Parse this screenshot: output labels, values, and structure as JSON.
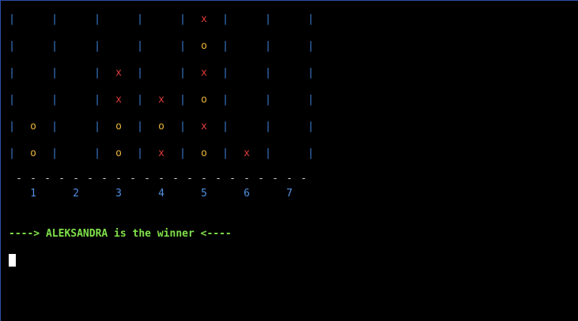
{
  "game": {
    "separator": "|",
    "tokens": {
      "x": "x",
      "o": "o"
    },
    "grid": [
      [
        "",
        "",
        "",
        "",
        "x",
        "",
        ""
      ],
      [
        "",
        "",
        "",
        "",
        "o",
        "",
        ""
      ],
      [
        "",
        "",
        "x",
        "",
        "x",
        "",
        ""
      ],
      [
        "",
        "",
        "x",
        "x",
        "o",
        "",
        ""
      ],
      [
        "o",
        "",
        "o",
        "o",
        "x",
        "",
        ""
      ],
      [
        "o",
        "",
        "o",
        "x",
        "o",
        "x",
        ""
      ]
    ],
    "column_numbers": [
      "1",
      "2",
      "3",
      "4",
      "5",
      "6",
      "7"
    ],
    "dash_char": "-",
    "dash_count": 21,
    "winner_message": "----> ALEKSANDRA is the winner <----"
  },
  "colors": {
    "background": "#000000",
    "separator": "#3d7fd6",
    "player_x": "#e03b3b",
    "player_o": "#e8b33a",
    "column_numbers": "#4f8fe0",
    "message": "#7fe04a",
    "cursor": "#ffffff"
  }
}
